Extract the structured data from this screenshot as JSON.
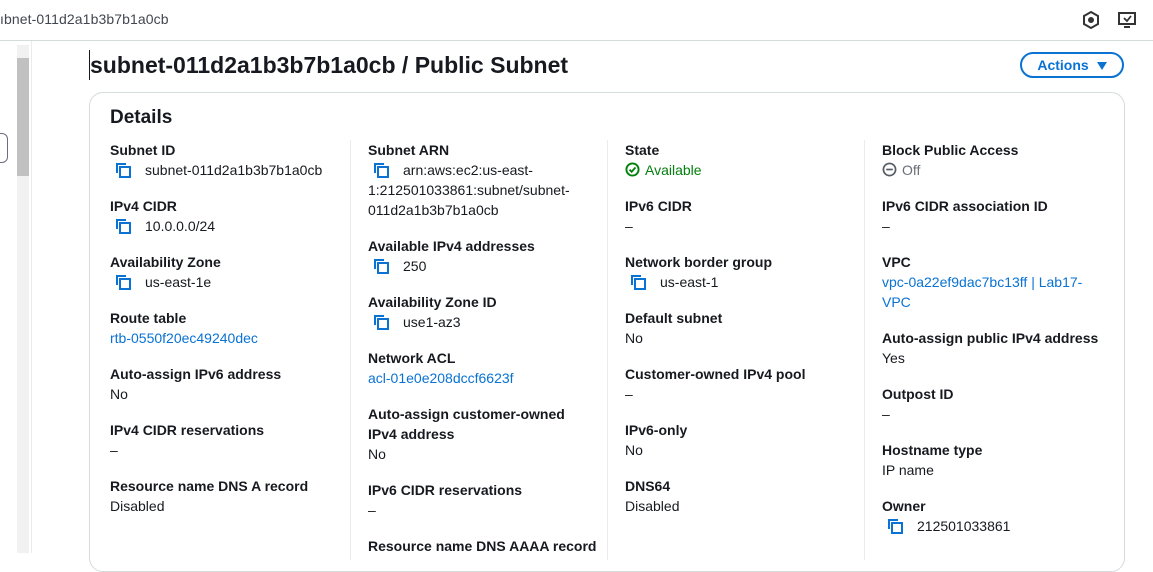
{
  "browser": {
    "tab_title": "ıbnet-011d2a1b3b7b1a0cb"
  },
  "page": {
    "title": "subnet-011d2a1b3b7b1a0cb / Public Subnet",
    "actions_label": "Actions"
  },
  "details": {
    "heading": "Details",
    "col1": [
      {
        "label": "Subnet ID",
        "value": "subnet-011d2a1b3b7b1a0cb"
      },
      {
        "label": "IPv4 CIDR",
        "value": "10.0.0.0/24"
      },
      {
        "label": "Availability Zone",
        "value": "us-east-1e"
      },
      {
        "label": "Route table",
        "value": "rtb-0550f20ec49240dec"
      },
      {
        "label": "Auto-assign IPv6 address",
        "value": "No"
      },
      {
        "label": "IPv4 CIDR reservations",
        "value": "–"
      },
      {
        "label": "Resource name DNS A record",
        "value": "Disabled"
      }
    ],
    "col2": [
      {
        "label": "Subnet ARN",
        "value_lines": [
          "arn:aws:ec2:us-east-",
          "1:212501033861:subnet/subnet-",
          "011d2a1b3b7b1a0cb"
        ]
      },
      {
        "label": "Available IPv4 addresses",
        "value": "250"
      },
      {
        "label": "Availability Zone ID",
        "value": "use1-az3"
      },
      {
        "label": "Network ACL",
        "value": "acl-01e0e208dccf6623f"
      },
      {
        "label_lines": [
          "Auto-assign customer-owned",
          "IPv4 address"
        ],
        "value": "No"
      },
      {
        "label": "IPv6 CIDR reservations",
        "value": "–"
      },
      {
        "label": "Resource name DNS AAAA record",
        "value": ""
      }
    ],
    "col3": [
      {
        "label": "State",
        "value": "Available"
      },
      {
        "label": "IPv6 CIDR",
        "value": "–"
      },
      {
        "label": "Network border group",
        "value": "us-east-1"
      },
      {
        "label": "Default subnet",
        "value": "No"
      },
      {
        "label": "Customer-owned IPv4 pool",
        "value": "–"
      },
      {
        "label": "IPv6-only",
        "value": "No"
      },
      {
        "label": "DNS64",
        "value": "Disabled"
      }
    ],
    "col4": [
      {
        "label": "Block Public Access",
        "value": "Off"
      },
      {
        "label": "IPv6 CIDR association ID",
        "value": "–"
      },
      {
        "label": "VPC",
        "value_lines": [
          "vpc-0a22ef9dac7bc13ff | Lab17-",
          "VPC"
        ]
      },
      {
        "label": "Auto-assign public IPv4 address",
        "value": "Yes"
      },
      {
        "label": "Outpost ID",
        "value": "–"
      },
      {
        "label": "Hostname type",
        "value": "IP name"
      },
      {
        "label": "Owner",
        "value": "212501033861"
      }
    ]
  },
  "colors": {
    "link": "#0972d3",
    "available": "#037f0c",
    "muted": "#687078"
  },
  "icons": {
    "copy": "copy-icon",
    "available": "check-circle-icon",
    "off": "minus-circle-icon"
  }
}
